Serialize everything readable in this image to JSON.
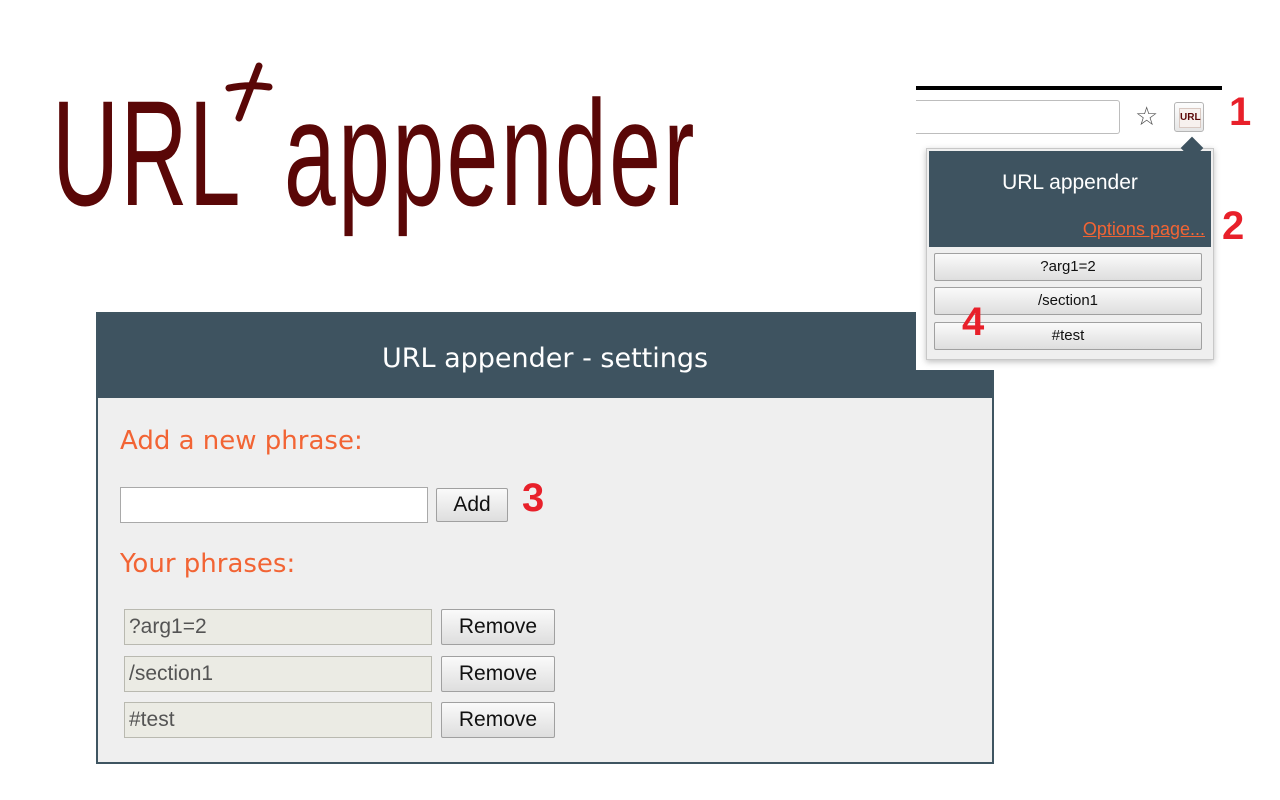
{
  "logo": {
    "text_url": "URL",
    "text_appender": "appender",
    "plus_icon": "plus-sign-icon",
    "color": "#5a0707"
  },
  "settings": {
    "title": "URL appender - settings",
    "add_heading": "Add a new phrase:",
    "new_phrase_value": "",
    "add_button": "Add",
    "phrases_heading": "Your phrases:",
    "phrases": [
      {
        "value": "?arg1=2",
        "remove_label": "Remove"
      },
      {
        "value": "/section1",
        "remove_label": "Remove"
      },
      {
        "value": "#test",
        "remove_label": "Remove"
      }
    ],
    "header_color": "#3e5360",
    "heading_color": "#f26434"
  },
  "browser": {
    "star_icon": "star-outline-icon",
    "extension_icon_text": "URL",
    "popup": {
      "title": "URL appender",
      "options_link": "Options page...",
      "items": [
        "?arg1=2",
        "/section1",
        "#test"
      ]
    }
  },
  "markers": [
    "1",
    "2",
    "3",
    "4"
  ],
  "marker_color": "#e8202a"
}
